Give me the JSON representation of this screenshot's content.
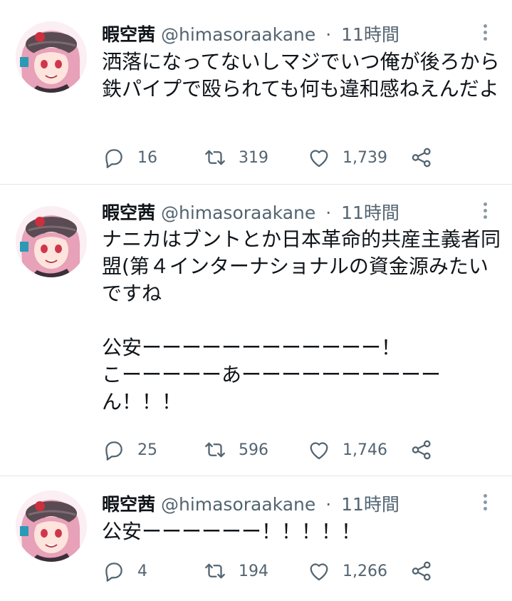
{
  "tweets": [
    {
      "display_name": "暇空茜",
      "handle": "@himasoraakane",
      "separator": "·",
      "time": "11時間",
      "text": "洒落になってないしマジでいつ俺が後ろから鉄パイプで殴られても何も違和感ねえんだよ",
      "replies": "16",
      "retweets": "319",
      "likes": "1,739"
    },
    {
      "display_name": "暇空茜",
      "handle": "@himasoraakane",
      "separator": "·",
      "time": "11時間",
      "text": "ナニカはブントとか日本革命的共産主義者同盟(第４インターナショナルの資金源みたいですね\n\n公安ーーーーーーーーーーーー！\nこーーーーーあーーーーーーーーーーん！！！",
      "replies": "25",
      "retweets": "596",
      "likes": "1,746"
    },
    {
      "display_name": "暇空茜",
      "handle": "@himasoraakane",
      "separator": "·",
      "time": "11時間",
      "text": "公安ーーーーーー！！！！！",
      "replies": "4",
      "retweets": "194",
      "likes": "1,266"
    }
  ],
  "icons": {
    "reply": "reply-icon",
    "retweet": "retweet-icon",
    "like": "heart-icon",
    "share": "share-icon",
    "more": "more-options-icon"
  },
  "colors": {
    "text": "#0f1419",
    "secondary": "#536471",
    "divider": "#e1e8ed"
  }
}
